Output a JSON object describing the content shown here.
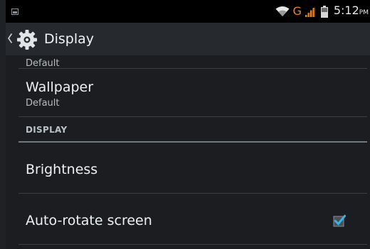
{
  "status_bar": {
    "network_type": "G",
    "time": "5:12",
    "ampm": "PM",
    "icons": [
      "notification-icon",
      "wifi-icon",
      "signal-icon",
      "battery-icon"
    ],
    "network_color": "#f0801b"
  },
  "action_bar": {
    "title": "Display",
    "icons": [
      "back-chevron-icon",
      "settings-gear-icon"
    ]
  },
  "list": {
    "cut_off_summary": "Default",
    "items": [
      {
        "title": "Wallpaper",
        "summary": "Default"
      }
    ],
    "section_header": "DISPLAY",
    "section_items": [
      {
        "title": "Brightness"
      },
      {
        "title": "Auto-rotate screen",
        "checked": true
      }
    ],
    "accent_color": "#33b5e5"
  }
}
